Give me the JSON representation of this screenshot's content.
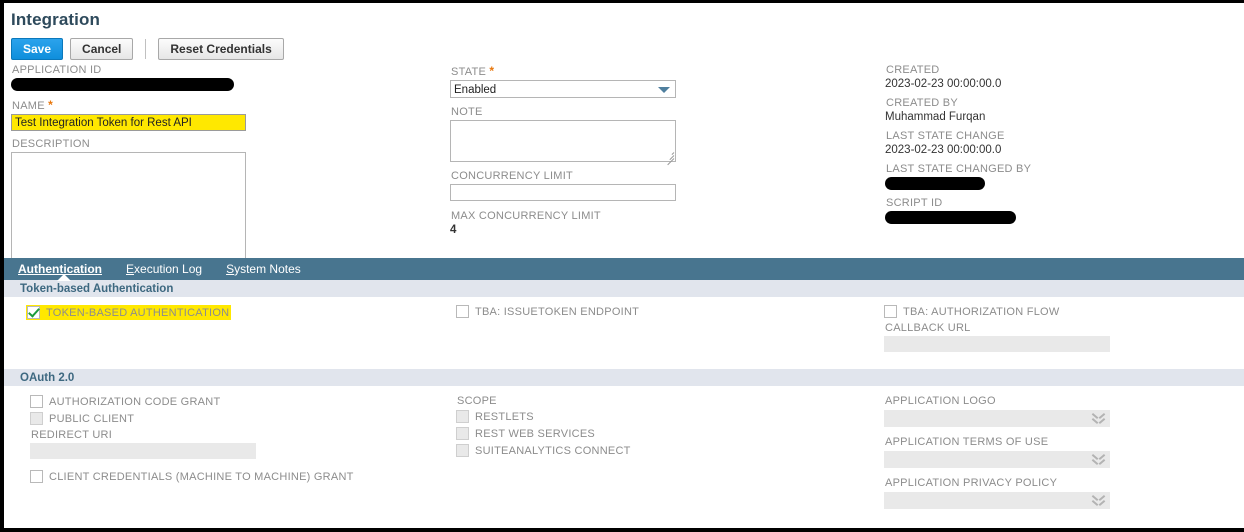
{
  "header": {
    "title": "Integration",
    "buttons": [
      {
        "label": "Save",
        "style": "primary",
        "name": "save-button"
      },
      {
        "label": "Cancel",
        "style": "secondary",
        "name": "cancel-button"
      },
      {
        "label": "Reset Credentials",
        "style": "secondary",
        "name": "reset-credentials-button"
      }
    ]
  },
  "form": {
    "application_id": {
      "label": "APPLICATION ID",
      "value": "",
      "redacted": true
    },
    "name": {
      "label": "NAME",
      "required": true,
      "value": "Test Integration Token for Rest API",
      "highlighted": true
    },
    "description": {
      "label": "DESCRIPTION",
      "value": ""
    },
    "state": {
      "label": "STATE",
      "required": true,
      "value": "Enabled"
    },
    "note": {
      "label": "NOTE",
      "value": ""
    },
    "concurrency_limit": {
      "label": "CONCURRENCY LIMIT",
      "value": ""
    },
    "max_concurrency_limit": {
      "label": "MAX CONCURRENCY LIMIT",
      "value": "4"
    },
    "created": {
      "label": "CREATED",
      "value": "2023-02-23 00:00:00.0"
    },
    "created_by": {
      "label": "CREATED BY",
      "value": "Muhammad Furqan"
    },
    "last_state_change": {
      "label": "LAST STATE CHANGE",
      "value": "2023-02-23 00:00:00.0"
    },
    "last_state_changed_by": {
      "label": "LAST STATE CHANGED BY",
      "value": "",
      "redacted": true
    },
    "script_id": {
      "label": "SCRIPT ID",
      "value": "",
      "redacted": true
    }
  },
  "tabs": [
    {
      "label": "Authentication",
      "accesskey": "A",
      "active": true
    },
    {
      "label": "Execution Log",
      "accesskey": "E",
      "active": false
    },
    {
      "label": "System Notes",
      "accesskey": "S",
      "active": false
    }
  ],
  "token_section": {
    "heading": "Token-based Authentication",
    "token_based_authentication": {
      "label": "TOKEN-BASED AUTHENTICATION",
      "checked": true,
      "highlighted": true
    },
    "tba_issuetoken_endpoint": {
      "label": "TBA: ISSUETOKEN ENDPOINT",
      "checked": false
    },
    "tba_authorization_flow": {
      "label": "TBA: AUTHORIZATION FLOW",
      "checked": false
    },
    "callback_url": {
      "label": "CALLBACK URL",
      "value": "",
      "disabled": true
    }
  },
  "oauth_section": {
    "heading": "OAuth 2.0",
    "authorization_code_grant": {
      "label": "AUTHORIZATION CODE GRANT",
      "checked": false,
      "disabled": false
    },
    "public_client": {
      "label": "PUBLIC CLIENT",
      "checked": false,
      "disabled": true
    },
    "redirect_uri": {
      "label": "REDIRECT URI",
      "value": "",
      "disabled": true
    },
    "client_credentials_grant": {
      "label": "CLIENT CREDENTIALS (MACHINE TO MACHINE) GRANT",
      "checked": false,
      "disabled": false
    },
    "scope": {
      "label": "SCOPE",
      "items": [
        {
          "label": "RESTLETS",
          "checked": false,
          "disabled": true
        },
        {
          "label": "REST WEB SERVICES",
          "checked": false,
          "disabled": true
        },
        {
          "label": "SUITEANALYTICS CONNECT",
          "checked": false,
          "disabled": true
        }
      ]
    },
    "application_logo": {
      "label": "APPLICATION LOGO",
      "value": "",
      "disabled": true
    },
    "application_terms_of_use": {
      "label": "APPLICATION TERMS OF USE",
      "value": "",
      "disabled": true
    },
    "application_privacy_policy": {
      "label": "APPLICATION PRIVACY POLICY",
      "value": "",
      "disabled": true
    }
  },
  "colors": {
    "tabbar": "#48758f",
    "section_header_bg": "#e1e5ed",
    "section_header_text": "#3d6880",
    "title": "#2e4a5c",
    "primary_button": "#1a9ae8",
    "highlight": "#ffe800",
    "required_star": "#e8770d",
    "check_mark": "#1a9b3c"
  }
}
